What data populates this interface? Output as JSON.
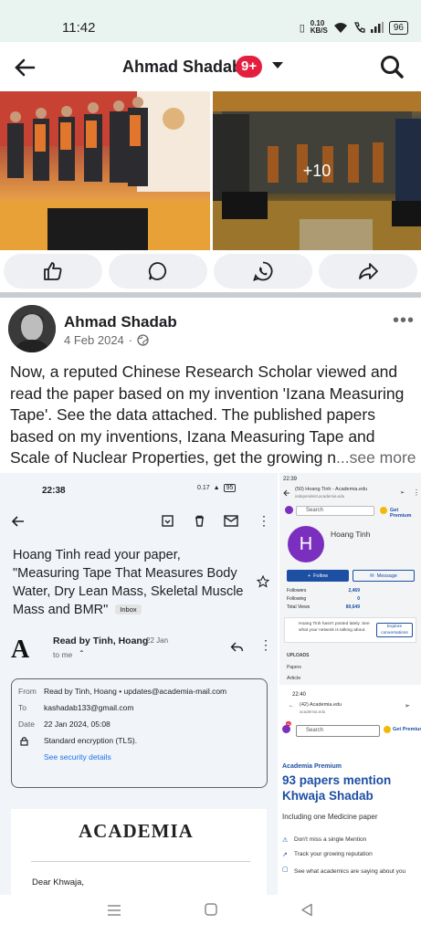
{
  "status_bar": {
    "time": "11:42",
    "speed_top": "0.10",
    "speed_bottom": "KB/S",
    "battery": "96"
  },
  "header": {
    "title": "Ahmad Shadab",
    "badge": "9+"
  },
  "photos": {
    "more_count": "+10"
  },
  "post": {
    "author": "Ahmad Shadab",
    "date": "4 Feb 2024",
    "text": "Now, a reputed Chinese Research Scholar viewed and read the paper based on my invention 'Izana Measuring Tape'. See the data attached. The published papers based on my inventions, Izana Measuring Tape and Scale of Nuclear Properties, get the growing n",
    "ellipsis": "...",
    "see_more": "see more"
  },
  "email_screenshot": {
    "time": "22:38",
    "speed": "0.17",
    "battery": "95",
    "subject": "Hoang Tinh read your paper, \"Measuring Tape That Measures Body Water, Dry Lean Mass, Skeletal Muscle Mass and BMR\"",
    "inbox_label": "Inbox",
    "sender": "Read by Tinh, Hoang",
    "sender_date": "22 Jan",
    "to_me": "to me",
    "details": {
      "from_label": "From",
      "from_value": "Read by Tinh, Hoang • updates@academia-mail.com",
      "to_label": "To",
      "to_value": "kashadab133@gmail.com",
      "date_label": "Date",
      "date_value": "22 Jan 2024, 05:08",
      "encryption": "Standard encryption (TLS).",
      "security_link": "See security details"
    },
    "logo": "ACADEMIA",
    "greeting": "Dear Khwaja,"
  },
  "academia_screenshot": {
    "time1": "22:39",
    "tab1": "(50) Hoang Tinh - Academia.edu",
    "url1": "independent.academia.edu",
    "search": "Search",
    "get_premium": "Get Premium",
    "profile_initial": "H",
    "profile_name": "Hoang Tinh",
    "follow": "Follow",
    "message": "Message",
    "stats": [
      {
        "label": "Followers",
        "value": "2,469"
      },
      {
        "label": "Following",
        "value": "0"
      },
      {
        "label": "Total Views",
        "value": "80,649"
      }
    ],
    "not_posted": "Hoang Tinh hasn't posted lately. See what your network is talking about.",
    "explore": "Explore conversations",
    "uploads": "UPLOADS",
    "papers": "Papers",
    "article": "Article",
    "time2": "22:40",
    "tab2": "(42) Academia.edu",
    "url2": "academia.edu",
    "avatar_badge": "42",
    "premium_label": "Academia Premium",
    "papers_mention": "93 papers mention Khwaja Shadab",
    "including": "Including one Medicine paper",
    "features": [
      "Don't miss a single Mention",
      "Track your growing reputation",
      "See what academics are saying about you"
    ]
  },
  "colors": {
    "badge": "#e41e3f",
    "academia_blue": "#1d4fa3",
    "profile_purple": "#7b2fbe"
  }
}
